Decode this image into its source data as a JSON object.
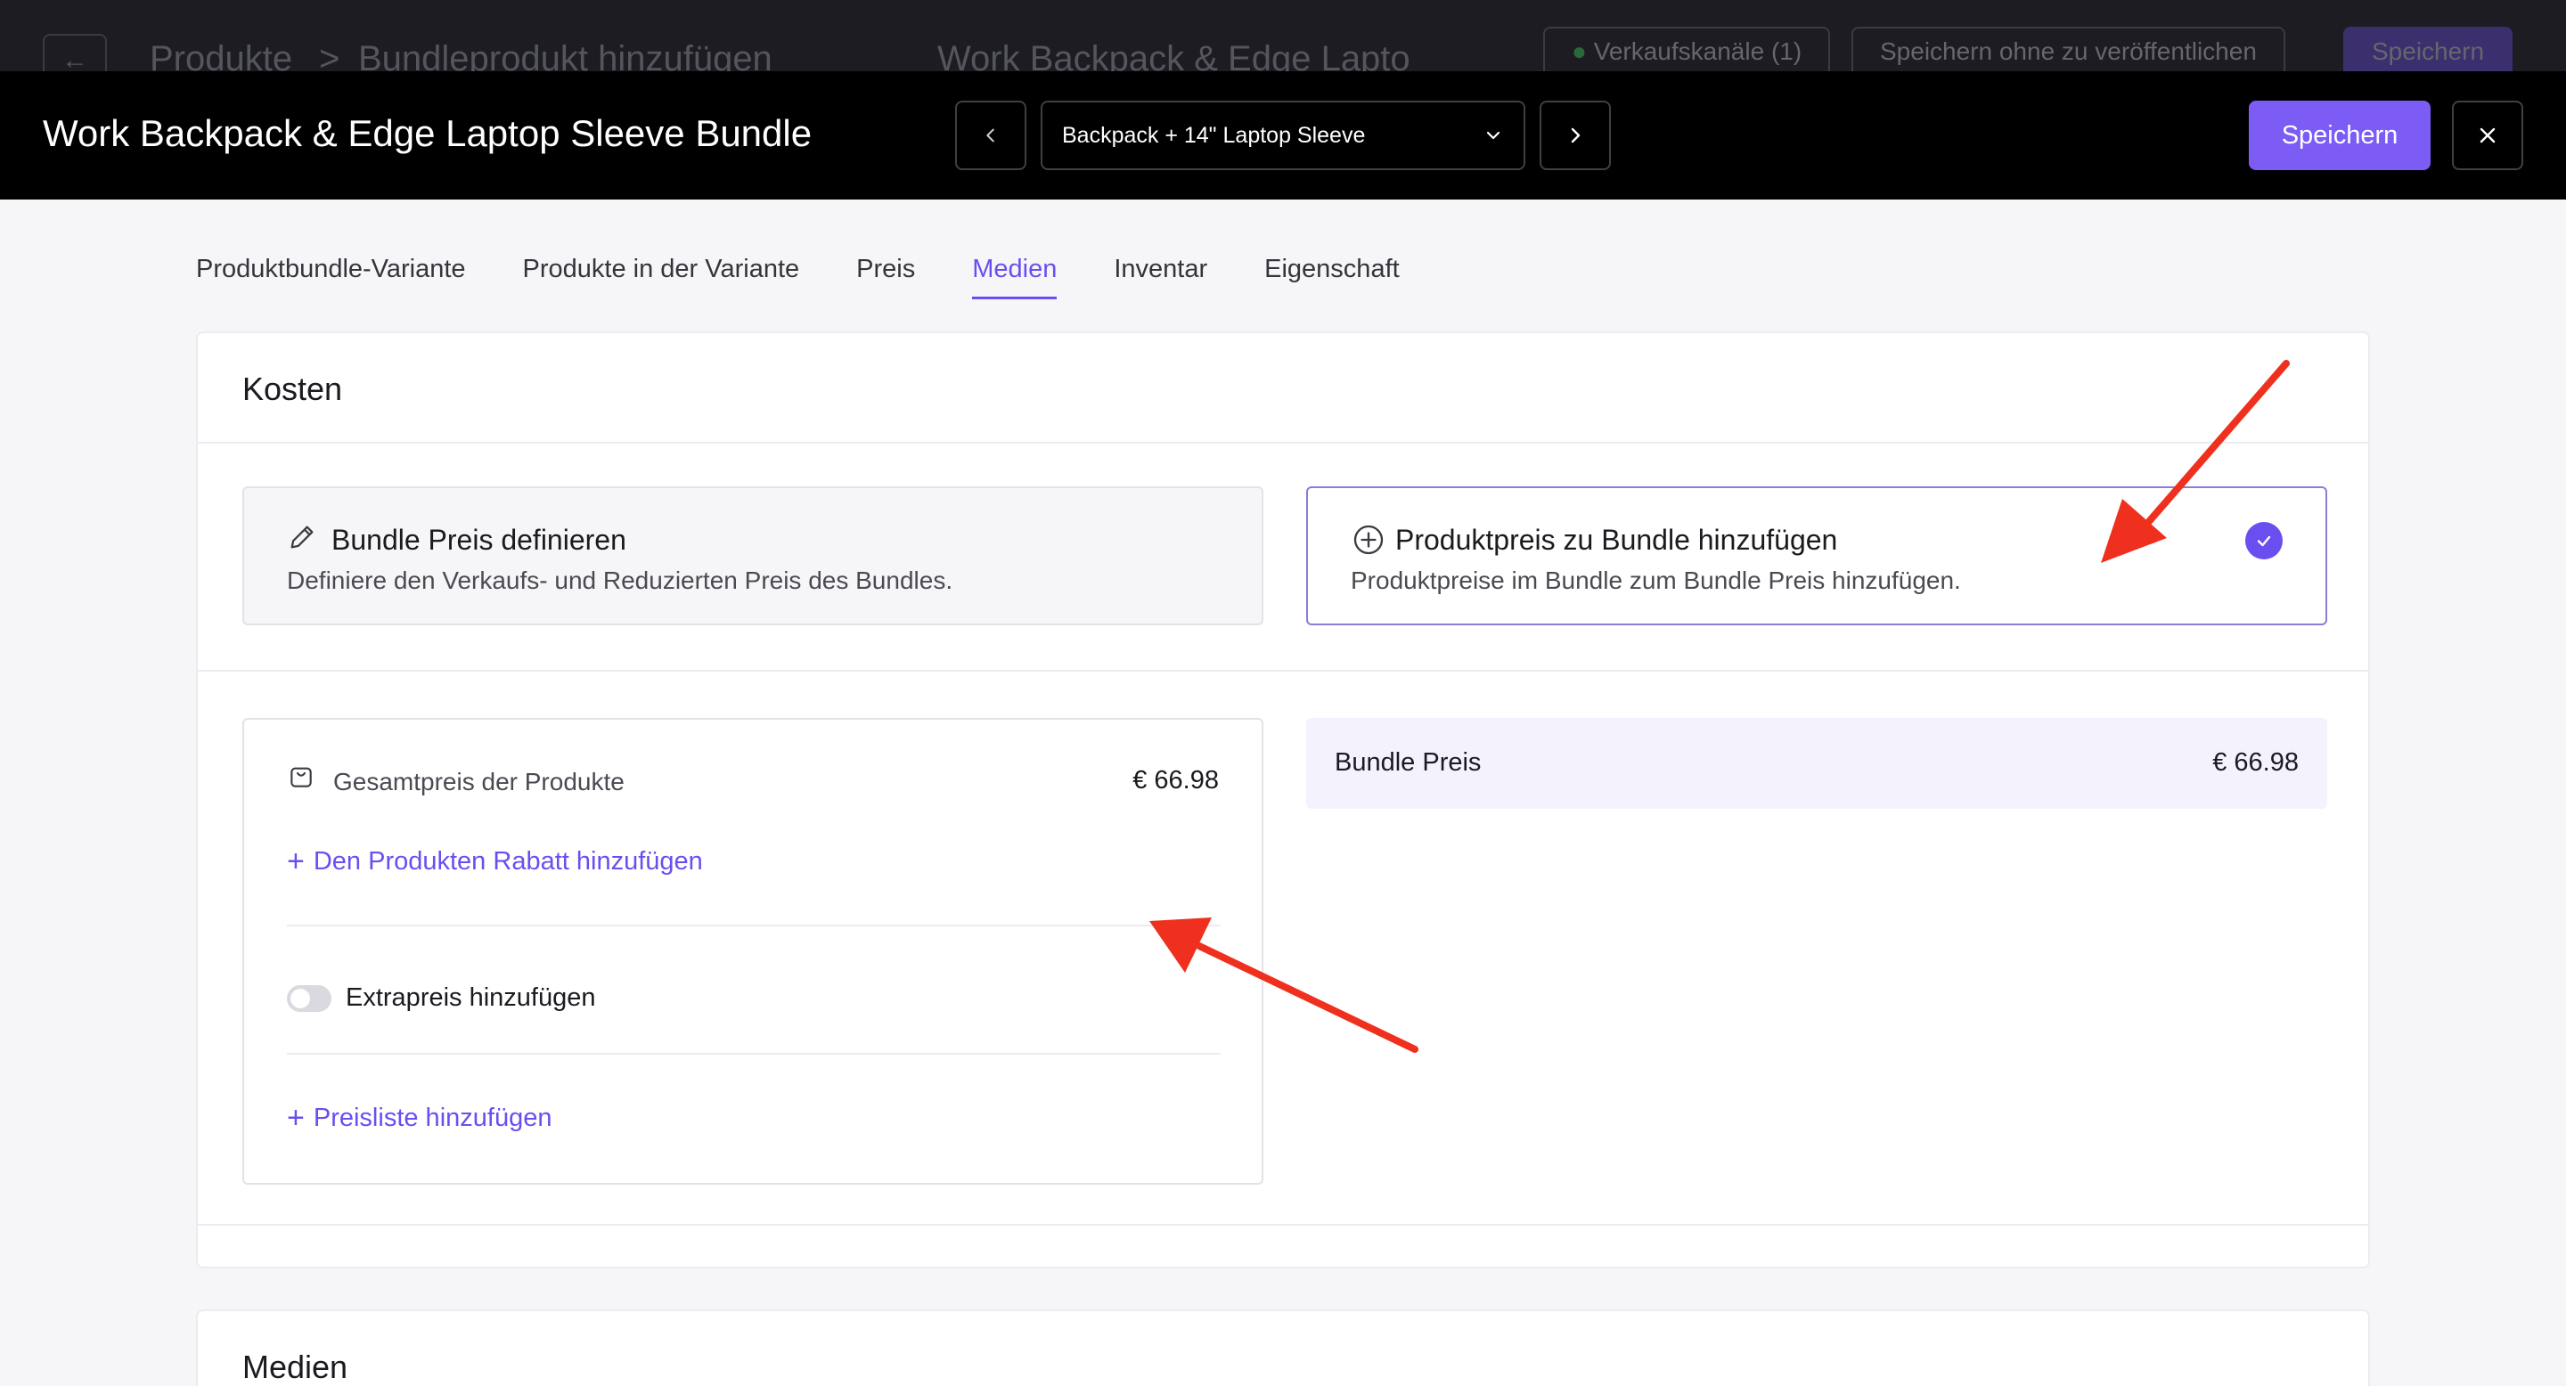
{
  "background_header": {
    "back_icon": "arrow-left-icon",
    "breadcrumb_root": "Produkte",
    "breadcrumb_separator": ">",
    "breadcrumb_current": "Bundleprodukt hinzufügen",
    "product_name": "Work Backpack & Edge Lapto",
    "channels_label": "Verkaufskanäle (1)",
    "save_draft_label": "Speichern ohne zu veröffentlichen",
    "save_label": "Speichern"
  },
  "modal": {
    "title": "Work Backpack & Edge Laptop Sleeve Bundle",
    "variant_selected": "Backpack + 14\" Laptop Sleeve",
    "save_label": "Speichern",
    "prev_icon": "chevron-left-icon",
    "next_icon": "chevron-right-icon",
    "close_icon": "close-icon"
  },
  "tabs": [
    {
      "label": "Produktbundle-Variante"
    },
    {
      "label": "Produkte in der Variante"
    },
    {
      "label": "Preis"
    },
    {
      "label": "Medien"
    },
    {
      "label": "Inventar"
    },
    {
      "label": "Eigenschaft"
    }
  ],
  "active_tab": "Medien",
  "costs": {
    "title": "Kosten",
    "option_define": {
      "icon": "pencil-icon",
      "title": "Bundle Preis definieren",
      "description": "Definiere den Verkaufs- und Reduzierten Preis des Bundles."
    },
    "option_add": {
      "icon": "plus-circle-icon",
      "title": "Produktpreis zu Bundle hinzufügen",
      "description": "Produktpreise im Bundle zum Bundle Preis hinzufügen.",
      "selected": true
    },
    "products_total": {
      "icon": "shopping-bag-icon",
      "label": "Gesamtpreis der Produkte",
      "value": "€ 66.98"
    },
    "add_discount_link": "Den Produkten Rabatt hinzufügen",
    "extra_price_toggle": {
      "label": "Extrapreis hinzufügen",
      "on": false
    },
    "add_pricelist_link": "Preisliste hinzufügen",
    "bundle_price": {
      "label": "Bundle Preis",
      "value": "€ 66.98"
    }
  },
  "media": {
    "title": "Medien"
  },
  "colors": {
    "accent": "#6b4ef0",
    "button": "#7c5cf5",
    "annotation_arrow": "#f0301e",
    "modal_bar": "#000000"
  }
}
